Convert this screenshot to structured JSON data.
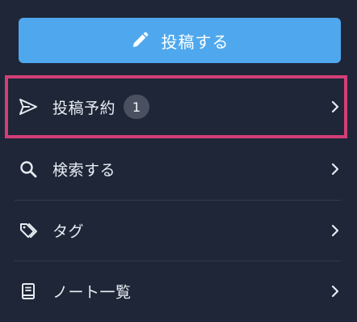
{
  "post_button": {
    "label": "投稿する",
    "icon": "pencil-icon"
  },
  "menu": {
    "items": [
      {
        "label": "投稿予約",
        "badge": "1",
        "icon": "send-icon"
      },
      {
        "label": "検索する",
        "icon": "search-icon"
      },
      {
        "label": "タグ",
        "icon": "tag-icon"
      },
      {
        "label": "ノート一覧",
        "icon": "notebook-icon"
      }
    ]
  },
  "colors": {
    "background": "#1e2637",
    "primary_button": "#4fa8ee",
    "highlight_border": "#d23f78",
    "badge_bg": "#4a5060"
  }
}
